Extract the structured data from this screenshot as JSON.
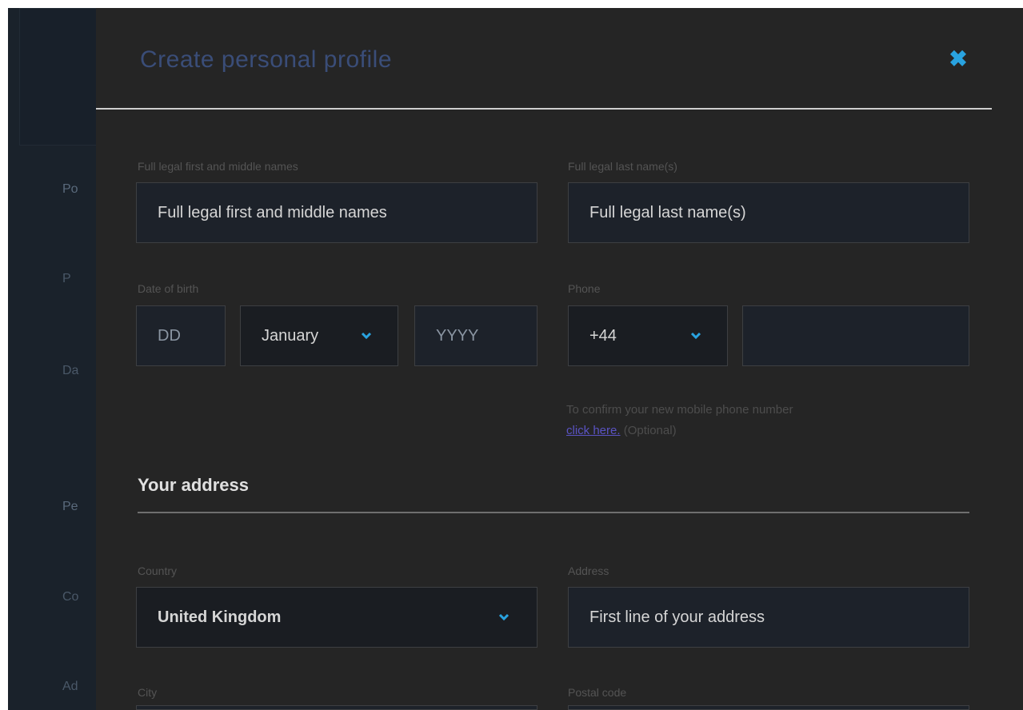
{
  "background": {
    "side_labels": [
      "Po",
      "P",
      "Da",
      "Pe",
      "Co",
      "Ad"
    ]
  },
  "modal": {
    "title": "Create personal profile",
    "close_icon": "close-icon",
    "accent_color": "#29a3e0"
  },
  "form": {
    "first_names": {
      "label": "Full legal first and middle names",
      "placeholder": "Full legal first and middle names"
    },
    "last_names": {
      "label": "Full legal last name(s)",
      "placeholder": "Full legal last name(s)"
    },
    "dob": {
      "label": "Date of birth",
      "day_placeholder": "DD",
      "month_value": "January",
      "year_placeholder": "YYYY"
    },
    "phone": {
      "label": "Phone",
      "country_code": "+44",
      "number_value": ""
    },
    "phone_helper": {
      "text": "To confirm your new mobile phone number",
      "link": "click here.",
      "suffix": "(Optional)"
    }
  },
  "address_section": {
    "heading": "Your address",
    "country": {
      "label": "Country",
      "value": "United Kingdom"
    },
    "address": {
      "label": "Address",
      "placeholder": "First line of your address"
    },
    "city": {
      "label": "City"
    },
    "postal_code": {
      "label": "Postal code"
    }
  }
}
